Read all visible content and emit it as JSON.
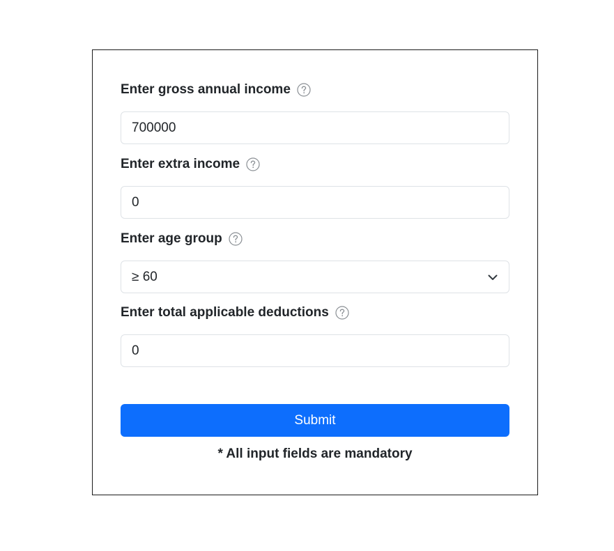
{
  "form": {
    "fields": [
      {
        "label": "Enter gross annual income",
        "value": "700000",
        "help_icon": "question-circle-icon"
      },
      {
        "label": "Enter extra income",
        "value": "0",
        "help_icon": "question-circle-icon"
      },
      {
        "label": "Enter age group",
        "value": "≥ 60",
        "help_icon": "question-circle-icon",
        "control": "select"
      },
      {
        "label": "Enter total applicable deductions",
        "value": "0",
        "help_icon": "question-circle-icon"
      }
    ],
    "submit_label": "Submit",
    "mandatory_note": "* All input fields are mandatory"
  },
  "colors": {
    "primary_button": "#0d6efd",
    "input_border": "#dee2e6",
    "card_border": "#1a1a1a",
    "text": "#212529",
    "help_icon": "#8a8f94"
  }
}
